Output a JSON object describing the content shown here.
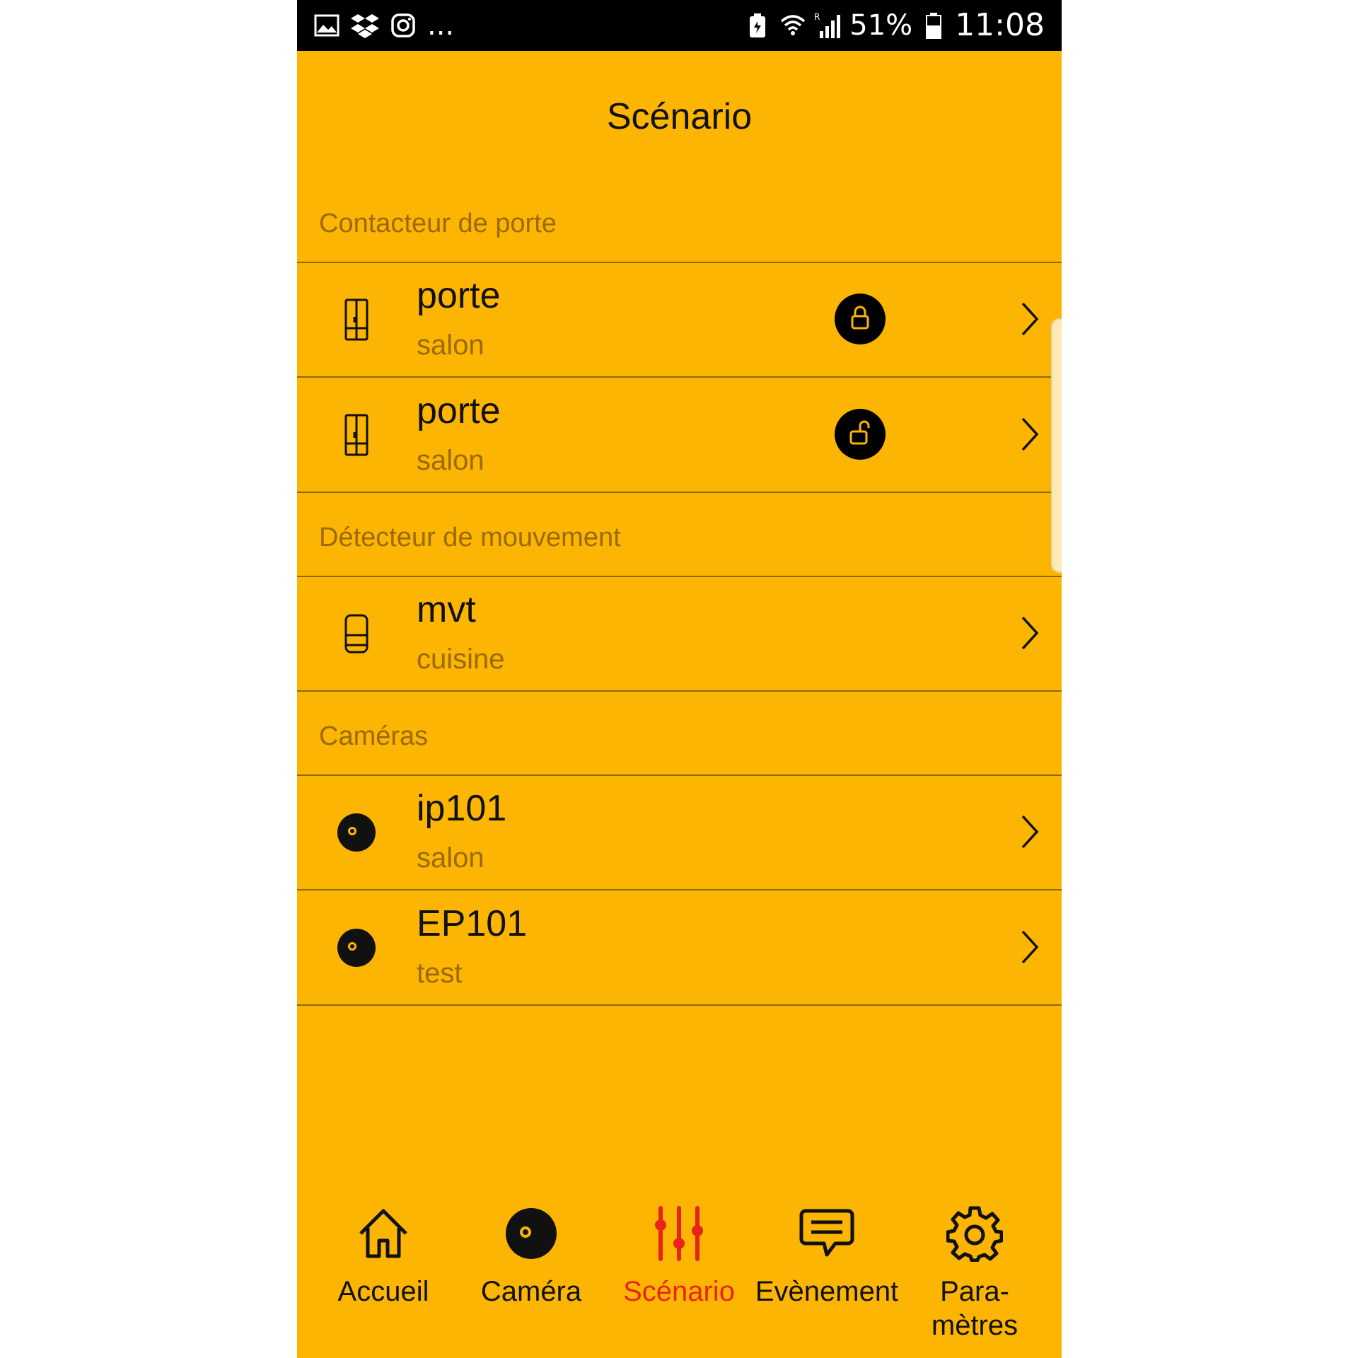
{
  "status_bar": {
    "left_icons": [
      "gallery-icon",
      "dropbox-icon",
      "instagram-icon"
    ],
    "more": "...",
    "battery_percent": "51%",
    "time": "11:08"
  },
  "header": {
    "title": "Scénario"
  },
  "sections": [
    {
      "label": "Contacteur de porte",
      "items": [
        {
          "name": "porte",
          "location": "salon",
          "icon": "door-sensor-icon",
          "lock_state": "locked"
        },
        {
          "name": "porte",
          "location": "salon",
          "icon": "door-sensor-icon",
          "lock_state": "unlocked"
        }
      ]
    },
    {
      "label": "Détecteur de mouvement",
      "items": [
        {
          "name": "mvt",
          "location": "cuisine",
          "icon": "motion-sensor-icon"
        }
      ]
    },
    {
      "label": "Caméras",
      "items": [
        {
          "name": "ip101",
          "location": "salon",
          "icon": "camera-icon"
        },
        {
          "name": "EP101",
          "location": "test",
          "icon": "camera-icon"
        }
      ]
    }
  ],
  "bottom_nav": [
    {
      "label": "Accueil",
      "icon": "home-icon",
      "active": false
    },
    {
      "label": "Caméra",
      "icon": "camera-icon",
      "active": false
    },
    {
      "label": "Scénario",
      "icon": "sliders-icon",
      "active": true
    },
    {
      "label": "Evènement",
      "icon": "chat-icon",
      "active": false
    },
    {
      "label": "Para-\nmètres",
      "icon": "gear-icon",
      "active": false
    }
  ],
  "colors": {
    "background": "#FCB502",
    "active": "#E8231C",
    "text": "#111111",
    "secondary_text": "#9A6A08"
  }
}
